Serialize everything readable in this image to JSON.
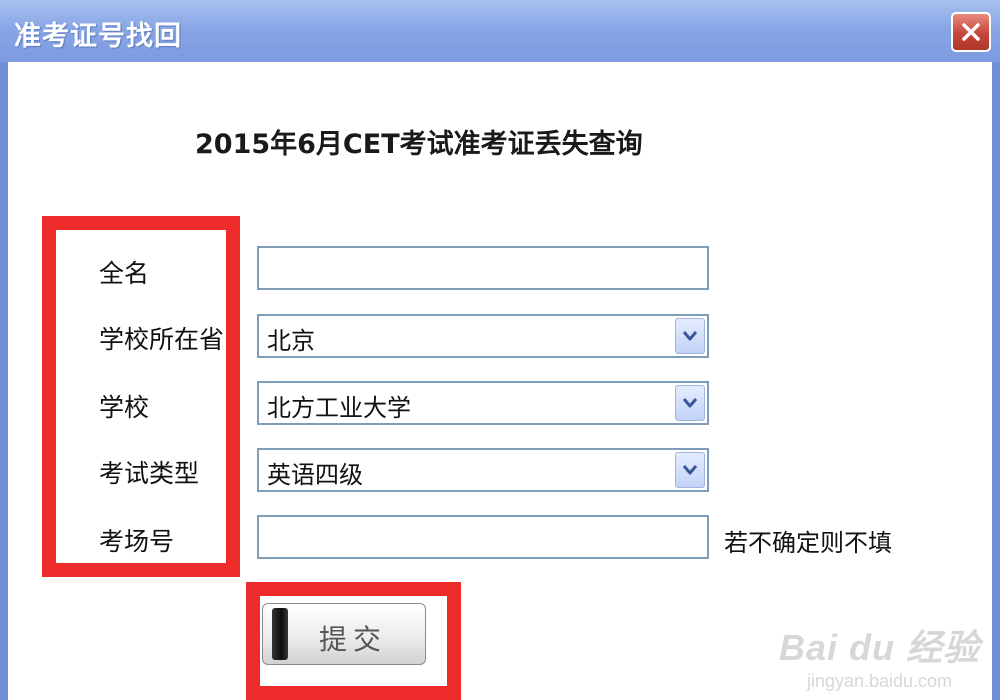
{
  "window": {
    "title": "准考证号找回"
  },
  "form": {
    "heading": "2015年6月CET考试准考证丢失查询",
    "fields": [
      {
        "label": "全名",
        "type": "text",
        "value": ""
      },
      {
        "label": "学校所在省",
        "type": "select",
        "value": "北京"
      },
      {
        "label": "学校",
        "type": "select",
        "value": "北方工业大学"
      },
      {
        "label": "考试类型",
        "type": "select",
        "value": "英语四级"
      },
      {
        "label": "考场号",
        "type": "text",
        "value": "",
        "hint": "若不确定则不填"
      }
    ],
    "submit_label": "提交"
  },
  "icons": {
    "close": "close-icon",
    "dropdown": "chevron-down-icon"
  },
  "colors": {
    "title_bar": "#7b9ae0",
    "close_button": "#c4473a",
    "highlight_box": "#ee2b2b",
    "field_border": "#7f9db9"
  },
  "watermark": {
    "brand": "Bai du 经验",
    "url": "jingyan.baidu.com"
  }
}
